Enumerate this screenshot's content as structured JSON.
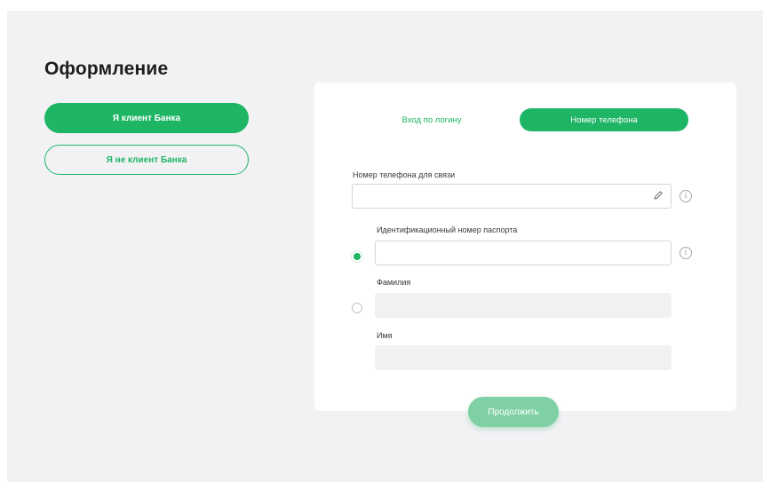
{
  "page": {
    "title": "Оформление"
  },
  "client_choice": {
    "is_client_label": "Я клиент Банка",
    "not_client_label": "Я не клиент Банка"
  },
  "tabs": {
    "login_label": "Вход по логину",
    "phone_label": "Номер телефона",
    "active": "phone"
  },
  "form": {
    "phone_label": "Номер телефона для связи",
    "phone_value": "",
    "passport_label": "Идентификационный номер паспорта",
    "passport_value": "",
    "surname_label": "Фамилия",
    "surname_value": "",
    "name_label": "Имя",
    "name_value": "",
    "selected_option": "passport"
  },
  "actions": {
    "continue_label": "Продолжить"
  },
  "colors": {
    "accent": "#1eb565",
    "accent_disabled": "#7fd1a5",
    "background": "#f2f2f5",
    "card": "#ffffff"
  },
  "icons": {
    "phone_edit": "pencil-icon",
    "phone_info": "info-icon",
    "passport_info": "info-icon"
  }
}
